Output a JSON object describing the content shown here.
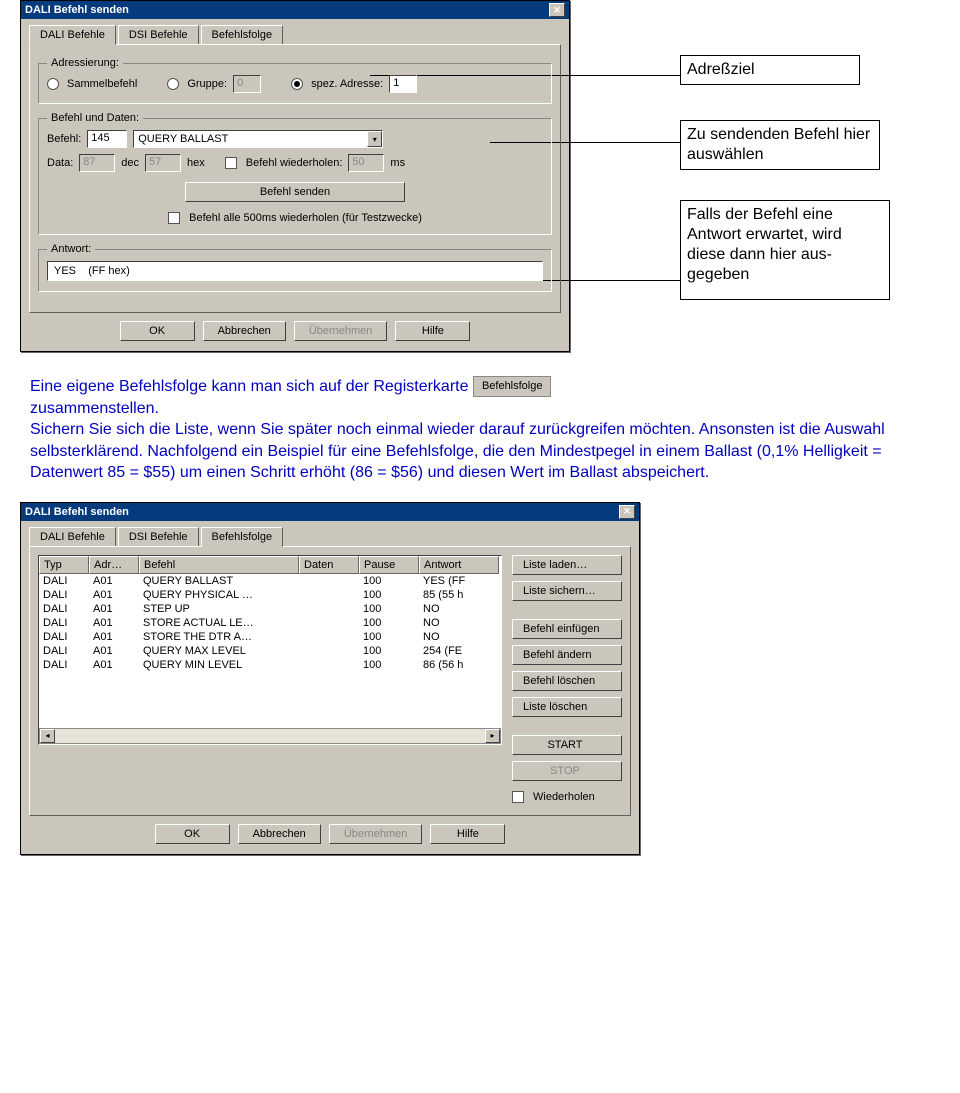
{
  "dlg1": {
    "title": "DALI Befehl senden",
    "tabs": [
      "DALI Befehle",
      "DSI Befehle",
      "Befehlsfolge"
    ],
    "active_tab": 0,
    "address_legend": "Adressierung:",
    "address_opts": {
      "sammel": "Sammelbefehl",
      "gruppe": "Gruppe:",
      "gruppe_val": "0",
      "spez": "spez. Adresse:",
      "spez_val": "1"
    },
    "cmd_legend": "Befehl und Daten:",
    "cmd": {
      "befehl_lbl": "Befehl:",
      "befehl_val": "145",
      "befehl_name": "QUERY BALLAST",
      "data_lbl": "Data:",
      "data_dec": "87",
      "dec_lbl": "dec",
      "data_hex": "57",
      "hex_lbl": "hex",
      "wiederholen_lbl": "Befehl wiederholen:",
      "wiederholen_val": "50",
      "ms_lbl": "ms",
      "send_btn": "Befehl senden",
      "alle500": "Befehl alle 500ms wiederholen (für Testzwecke)"
    },
    "antwort_legend": "Antwort:",
    "antwort_val": "YES    (FF hex)",
    "buttons": {
      "ok": "OK",
      "cancel": "Abbrechen",
      "apply": "Übernehmen",
      "help": "Hilfe"
    }
  },
  "annotations": {
    "a1": "Adreßziel",
    "a2": "Zu sendenden Befehl hier auswählen",
    "a3": "Falls der Befehl eine Antwort erwartet, wird diese dann hier aus-gegeben"
  },
  "paragraph": {
    "p1": "Eine eigene Befehlsfolge kann man sich auf der Registerkarte",
    "tabimg": "Befehlsfolge",
    "p2": "zusammenstellen.",
    "p3": "Sichern Sie sich die Liste, wenn Sie später noch einmal wieder darauf zurückgreifen möchten. Ansonsten ist die Auswahl selbsterklärend. Nachfolgend ein Beispiel für eine Befehlsfolge, die den Mindestpegel in einem Ballast (0,1% Helligkeit = Datenwert 85 = $55) um einen Schritt erhöht (86 = $56) und diesen Wert im Ballast abspeichert."
  },
  "dlg2": {
    "title": "DALI Befehl senden",
    "tabs": [
      "DALI Befehle",
      "DSI Befehle",
      "Befehlsfolge"
    ],
    "active_tab": 2,
    "headers": [
      "Typ",
      "Adr…",
      "Befehl",
      "Daten",
      "Pause",
      "Antwort"
    ],
    "rows": [
      [
        "DALI",
        "A01",
        "QUERY BALLAST",
        "",
        "100",
        "YES   (FF"
      ],
      [
        "DALI",
        "A01",
        "QUERY PHYSICAL …",
        "",
        "100",
        "85   (55 h"
      ],
      [
        "DALI",
        "A01",
        "STEP UP",
        "",
        "100",
        "NO"
      ],
      [
        "DALI",
        "A01",
        "STORE ACTUAL LE…",
        "",
        "100",
        "NO"
      ],
      [
        "DALI",
        "A01",
        "STORE THE DTR A…",
        "",
        "100",
        "NO"
      ],
      [
        "DALI",
        "A01",
        "QUERY MAX LEVEL",
        "",
        "100",
        "254   (FE"
      ],
      [
        "DALI",
        "A01",
        "QUERY MIN LEVEL",
        "",
        "100",
        "86   (56 h"
      ]
    ],
    "sidebtns": [
      "Liste laden…",
      "Liste sichern…",
      "Befehl einfügen",
      "Befehl ändern",
      "Befehl löschen",
      "Liste löschen",
      "START",
      "STOP"
    ],
    "wiederholen": "Wiederholen",
    "buttons": {
      "ok": "OK",
      "cancel": "Abbrechen",
      "apply": "Übernehmen",
      "help": "Hilfe"
    }
  }
}
